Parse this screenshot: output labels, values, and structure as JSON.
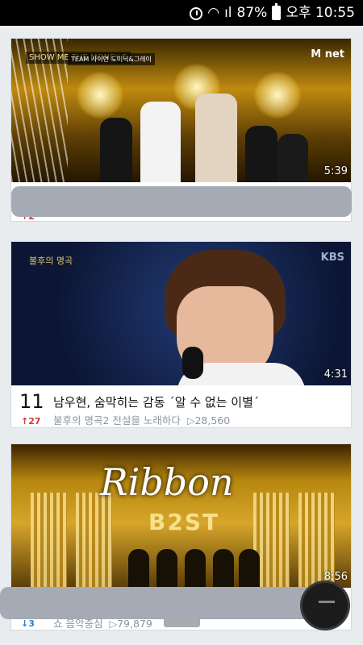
{
  "status_bar": {
    "signal_label": "ıl",
    "battery_percent": "87%",
    "time": "오후 10:55"
  },
  "videos": [
    {
      "duration": "5:39",
      "rank_change": "↑2",
      "rank_direction": "up",
      "overlay_logo_left": "SHOW ME THE MONEY 5",
      "overlay_caption": "TEAM 사이먼 도미닉&그레이",
      "overlay_logo_right": "M net"
    },
    {
      "rank": "11",
      "rank_change": "↑27",
      "rank_direction": "up",
      "title": "남우현, 숨막히는 감동 ´알 수 없는 이별´",
      "subtitle": "불후의 명곡2 전설을 노래하다",
      "views": "▷28,560",
      "duration": "4:31",
      "overlay_logo_left": "불후의 명곡",
      "overlay_logo_right": "KBS"
    },
    {
      "duration": "8:56",
      "rank_change": "↓3",
      "rank_direction": "down",
      "subtitle": "쇼 음악중심",
      "views": "▷79,879",
      "overlay_script": "Ribbon",
      "overlay_emblem": "B2ST"
    }
  ],
  "colors": {
    "rank_up": "#e03434",
    "rank_down": "#2f7ec4",
    "meta_gray": "#8b959f"
  }
}
